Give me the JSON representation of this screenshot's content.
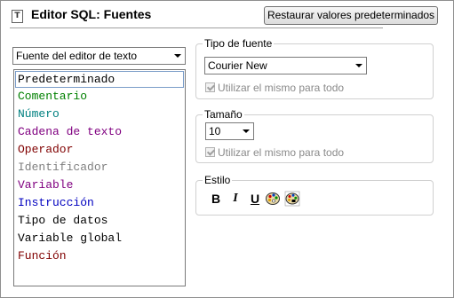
{
  "header": {
    "title": "Editor SQL: Fuentes",
    "reset_button": "Restaurar valores predeterminados"
  },
  "editor_combo": {
    "value": "Fuente del editor de texto"
  },
  "list": {
    "items": [
      {
        "label": "Predeterminado",
        "color": "#000000",
        "selected": true
      },
      {
        "label": "Comentario",
        "color": "#008000"
      },
      {
        "label": "Número",
        "color": "#008080"
      },
      {
        "label": "Cadena de texto",
        "color": "#800080"
      },
      {
        "label": "Operador",
        "color": "#800000"
      },
      {
        "label": "Identificador",
        "color": "#808080"
      },
      {
        "label": "Variable",
        "color": "#800080"
      },
      {
        "label": "Instrucción",
        "color": "#0000c0"
      },
      {
        "label": "Tipo de datos",
        "color": "#000000"
      },
      {
        "label": "Variable global",
        "color": "#000000"
      },
      {
        "label": "Función",
        "color": "#800000"
      }
    ]
  },
  "font_type": {
    "label": "Tipo de fuente",
    "value": "Courier New",
    "checkbox": "Utilizar el mismo para todo"
  },
  "size": {
    "label": "Tamaño",
    "value": "10",
    "checkbox": "Utilizar el mismo para todo"
  },
  "style": {
    "label": "Estilo",
    "bold": "B",
    "italic": "I",
    "underline": "U"
  }
}
